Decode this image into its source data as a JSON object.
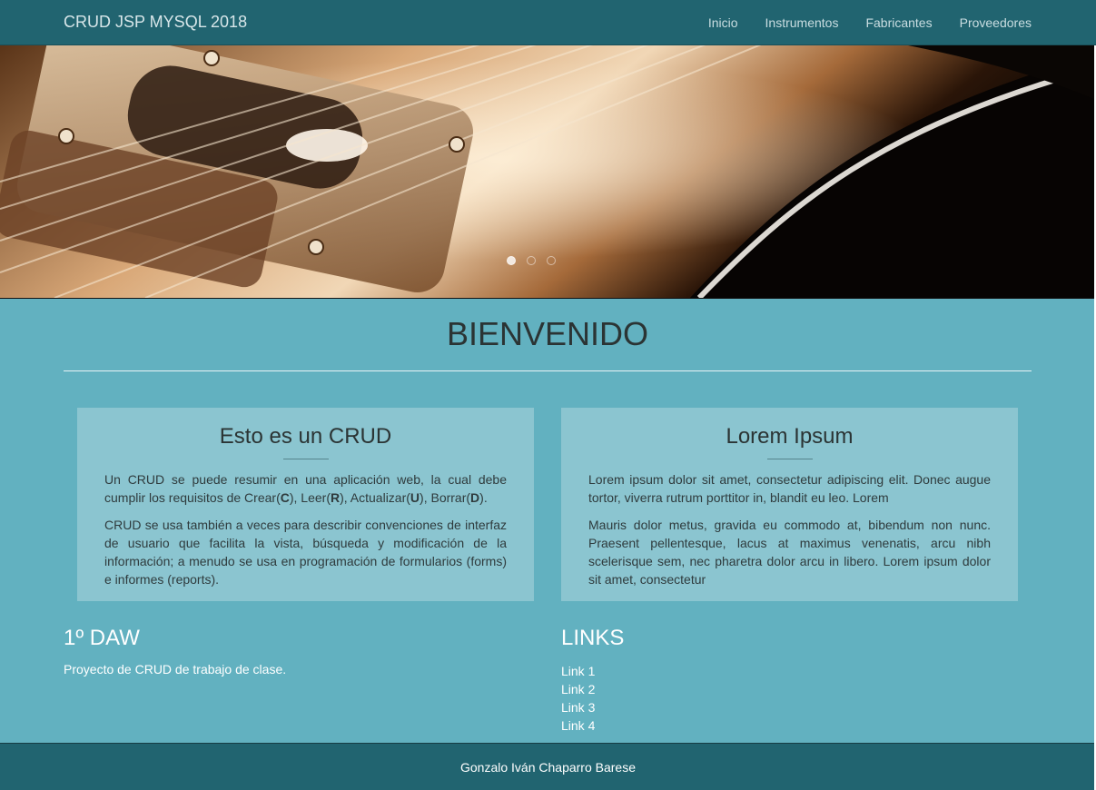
{
  "navbar": {
    "brand": "CRUD JSP MYSQL 2018",
    "links": [
      "Inicio",
      "Instrumentos",
      "Fabricantes",
      "Proveedores"
    ]
  },
  "carousel": {
    "slides": 3,
    "active_index": 0,
    "image": "guitar-pickup-photo"
  },
  "main": {
    "heading": "BIENVENIDO",
    "cards": [
      {
        "title": "Esto es un CRUD",
        "p1_before": "Un CRUD se puede resumir en una aplicación web, la cual debe cumplir los requisitos de Crear(",
        "p1_c": "C",
        "p1_mid1": "), Leer(",
        "p1_r": "R",
        "p1_mid2": "), Actualizar(",
        "p1_u": "U",
        "p1_mid3": "), Borrar(",
        "p1_d": "D",
        "p1_end": ").",
        "p2": "CRUD se usa también a veces para describir convenciones de interfaz de usuario que facilita la vista, búsqueda y modificación de la información; a menudo se usa en programación de formularios (forms) e informes (reports)."
      },
      {
        "title": "Lorem Ipsum",
        "p1": "Lorem ipsum dolor sit amet, consectetur adipiscing elit. Donec augue tortor, viverra rutrum porttitor in, blandit eu leo. Lorem",
        "p2": "Mauris dolor metus, gravida eu commodo at, bibendum non nunc. Praesent pellentesque, lacus at maximus venenatis, arcu nibh scelerisque sem, nec pharetra dolor arcu in libero. Lorem ipsum dolor sit amet, consectetur"
      }
    ],
    "about": {
      "title": "1º DAW",
      "text": "Proyecto de CRUD de trabajo de clase."
    },
    "links": {
      "title": "LINKS",
      "items": [
        "Link 1",
        "Link 2",
        "Link 3",
        "Link 4"
      ]
    }
  },
  "footer": {
    "text": "Gonzalo Iván Chaparro Barese"
  },
  "colors": {
    "navbar": "#216470",
    "main_bg": "#62b1c0",
    "card_bg": "#8bc5d0",
    "footer": "#216470"
  }
}
